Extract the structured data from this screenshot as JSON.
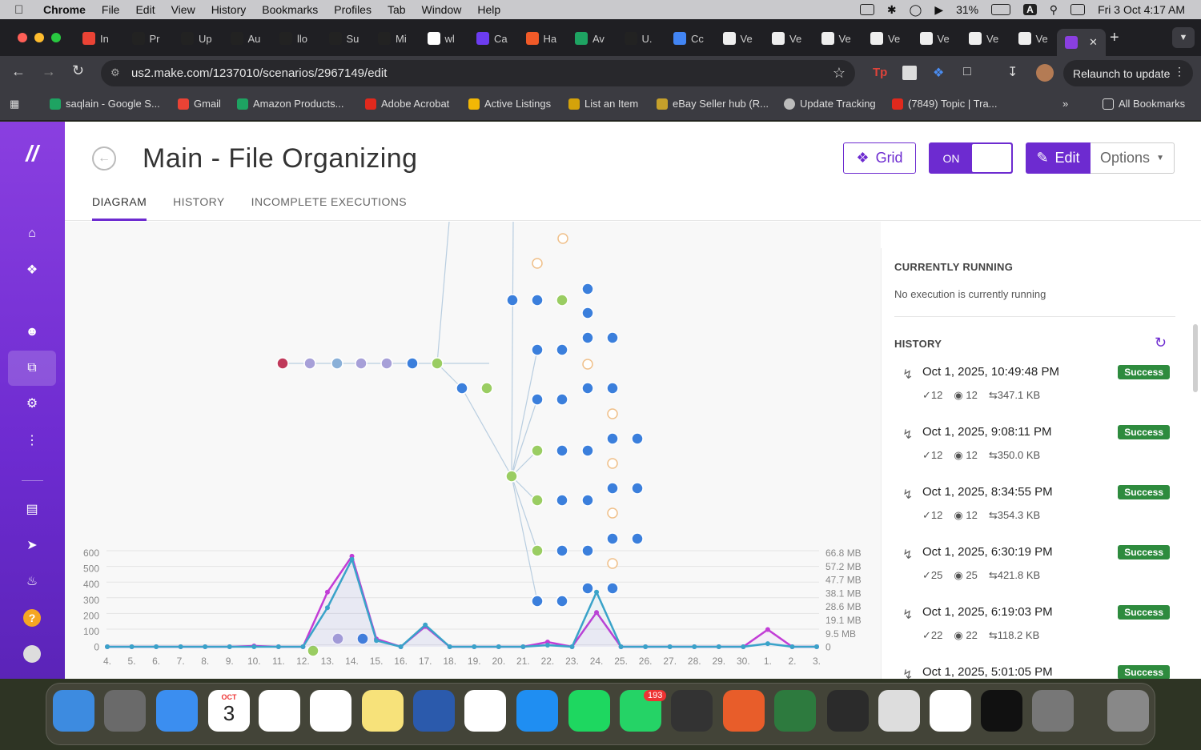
{
  "menubar": {
    "app": "Chrome",
    "items": [
      "File",
      "Edit",
      "View",
      "History",
      "Bookmarks",
      "Profiles",
      "Tab",
      "Window",
      "Help"
    ],
    "battery": "31%",
    "datetime": "Fri 3 Oct  4:17 AM"
  },
  "tabs": [
    {
      "label": "In"
    },
    {
      "label": "Pr"
    },
    {
      "label": "Up"
    },
    {
      "label": "Au"
    },
    {
      "label": "llo"
    },
    {
      "label": "Su"
    },
    {
      "label": "Mi"
    },
    {
      "label": "wl"
    },
    {
      "label": "Ca"
    },
    {
      "label": "Ha"
    },
    {
      "label": "Av"
    },
    {
      "label": "U."
    },
    {
      "label": "Cc"
    },
    {
      "label": "Ve"
    },
    {
      "label": "Ve"
    },
    {
      "label": "Ve"
    },
    {
      "label": "Ve"
    },
    {
      "label": "Ve"
    },
    {
      "label": "Ve"
    },
    {
      "label": "Ve"
    }
  ],
  "url": "us2.make.com/1237010/scenarios/2967149/edit",
  "relaunch": "Relaunch to update",
  "bookmarks": [
    "saqlain - Google S...",
    "Gmail",
    "Amazon Products...",
    "Adobe Acrobat",
    "Active Listings",
    "List an Item",
    "eBay Seller hub (R...",
    "Update Tracking",
    "(7849) Topic | Tra...",
    "All Bookmarks"
  ],
  "page": {
    "title": "Main - File Organizing",
    "tabs": [
      "DIAGRAM",
      "HISTORY",
      "INCOMPLETE EXECUTIONS"
    ],
    "grid": "Grid",
    "toggle": "ON",
    "edit": "Edit",
    "options": "Options"
  },
  "panel": {
    "running_title": "CURRENTLY RUNNING",
    "running_text": "No execution is currently running",
    "history_title": "HISTORY"
  },
  "history": [
    {
      "date": "Oct 1, 2025, 10:49:48 PM",
      "ops": "12",
      "views": "12",
      "size": "347.1 KB",
      "status": "Success"
    },
    {
      "date": "Oct 1, 2025, 9:08:11 PM",
      "ops": "12",
      "views": "12",
      "size": "350.0 KB",
      "status": "Success"
    },
    {
      "date": "Oct 1, 2025, 8:34:55 PM",
      "ops": "12",
      "views": "12",
      "size": "354.3 KB",
      "status": "Success"
    },
    {
      "date": "Oct 1, 2025, 6:30:19 PM",
      "ops": "25",
      "views": "25",
      "size": "421.8 KB",
      "status": "Success"
    },
    {
      "date": "Oct 1, 2025, 6:19:03 PM",
      "ops": "22",
      "views": "22",
      "size": "118.2 KB",
      "status": "Success"
    },
    {
      "date": "Oct 1, 2025, 5:01:05 PM",
      "ops": "",
      "views": "",
      "size": "",
      "status": "Success"
    }
  ],
  "chart_data": {
    "type": "line",
    "x": [
      "4.",
      "5.",
      "6.",
      "7.",
      "8.",
      "9.",
      "10.",
      "11.",
      "12.",
      "13.",
      "14.",
      "15.",
      "16.",
      "17.",
      "18.",
      "19.",
      "20.",
      "21.",
      "22.",
      "23.",
      "24.",
      "25.",
      "26.",
      "27.",
      "28.",
      "29.",
      "30.",
      "1.",
      "2.",
      "3."
    ],
    "yleft_ticks": [
      "600",
      "500",
      "400",
      "300",
      "200",
      "100",
      "0"
    ],
    "yright_ticks": [
      "66.8 MB",
      "57.2 MB",
      "47.7 MB",
      "38.1 MB",
      "28.6 MB",
      "19.1 MB",
      "9.5 MB",
      "0"
    ],
    "ylim": [
      0,
      600
    ],
    "series": [
      {
        "color": "#c23dd6",
        "values": [
          0,
          0,
          0,
          0,
          0,
          0,
          5,
          0,
          0,
          350,
          580,
          50,
          0,
          130,
          0,
          0,
          0,
          0,
          30,
          0,
          220,
          0,
          0,
          0,
          0,
          0,
          0,
          110,
          0,
          0
        ]
      },
      {
        "color": "#3aa3c9",
        "values": [
          0,
          0,
          0,
          0,
          0,
          0,
          0,
          0,
          0,
          250,
          560,
          40,
          0,
          140,
          0,
          0,
          0,
          0,
          10,
          0,
          350,
          0,
          0,
          0,
          0,
          0,
          0,
          20,
          0,
          0
        ]
      }
    ]
  },
  "dock": {
    "calendar_month": "OCT",
    "calendar_day": "3",
    "whatsapp_badge": "193"
  }
}
